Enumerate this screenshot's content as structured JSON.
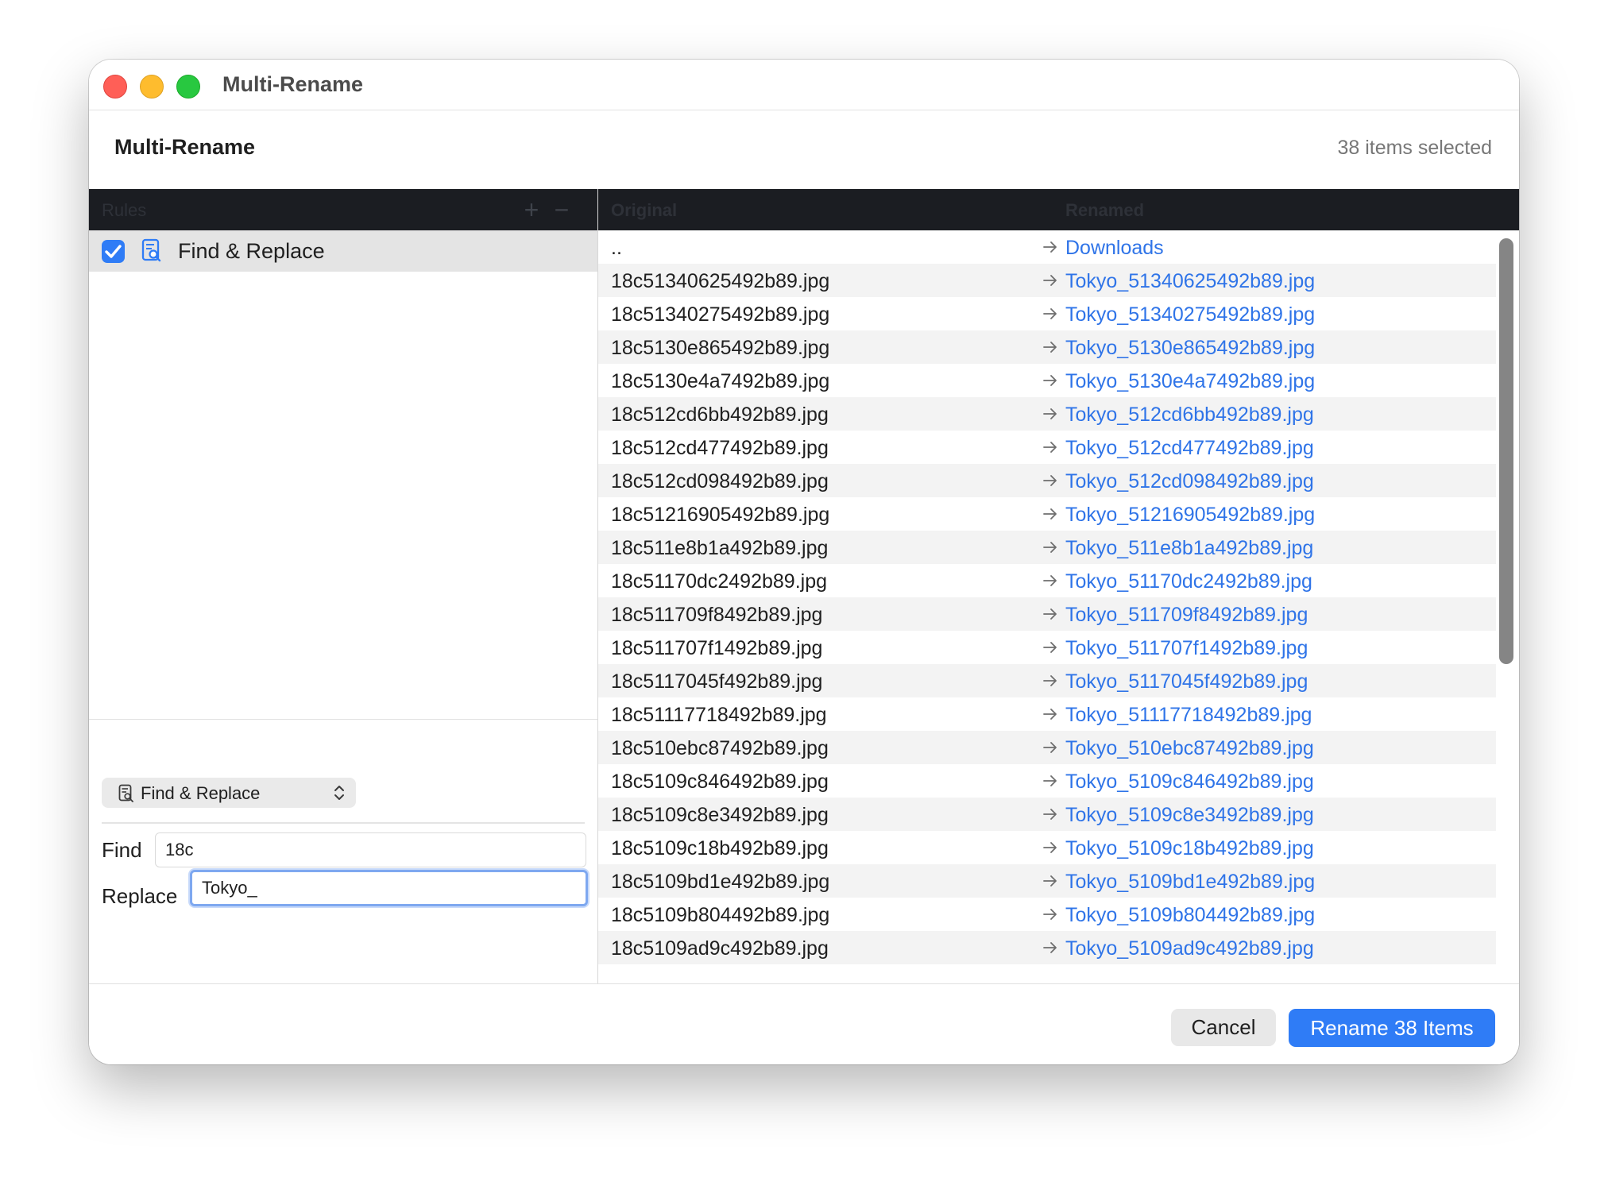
{
  "window": {
    "title": "Multi-Rename"
  },
  "header": {
    "title": "Multi-Rename",
    "selected_count": "38 items selected"
  },
  "rules": {
    "header_label": "Rules",
    "add_icon": "plus-icon",
    "remove_icon": "minus-icon",
    "items": [
      {
        "label": "Find & Replace",
        "checked": true,
        "icon": "document-search-icon"
      }
    ],
    "selected_rule_type": "Find & Replace",
    "find_label": "Find",
    "find_value": "18c",
    "replace_label": "Replace",
    "replace_value": "Tokyo_"
  },
  "preview": {
    "columns": {
      "original": "Original",
      "renamed": "Renamed"
    },
    "rows": [
      {
        "original": "..",
        "renamed": "Downloads"
      },
      {
        "original": "18c51340625492b89.jpg",
        "renamed": "Tokyo_51340625492b89.jpg"
      },
      {
        "original": "18c51340275492b89.jpg",
        "renamed": "Tokyo_51340275492b89.jpg"
      },
      {
        "original": "18c5130e865492b89.jpg",
        "renamed": "Tokyo_5130e865492b89.jpg"
      },
      {
        "original": "18c5130e4a7492b89.jpg",
        "renamed": "Tokyo_5130e4a7492b89.jpg"
      },
      {
        "original": "18c512cd6bb492b89.jpg",
        "renamed": "Tokyo_512cd6bb492b89.jpg"
      },
      {
        "original": "18c512cd477492b89.jpg",
        "renamed": "Tokyo_512cd477492b89.jpg"
      },
      {
        "original": "18c512cd098492b89.jpg",
        "renamed": "Tokyo_512cd098492b89.jpg"
      },
      {
        "original": "18c51216905492b89.jpg",
        "renamed": "Tokyo_51216905492b89.jpg"
      },
      {
        "original": "18c511e8b1a492b89.jpg",
        "renamed": "Tokyo_511e8b1a492b89.jpg"
      },
      {
        "original": "18c51170dc2492b89.jpg",
        "renamed": "Tokyo_51170dc2492b89.jpg"
      },
      {
        "original": "18c511709f8492b89.jpg",
        "renamed": "Tokyo_511709f8492b89.jpg"
      },
      {
        "original": "18c511707f1492b89.jpg",
        "renamed": "Tokyo_511707f1492b89.jpg"
      },
      {
        "original": "18c5117045f492b89.jpg",
        "renamed": "Tokyo_5117045f492b89.jpg"
      },
      {
        "original": "18c51117718492b89.jpg",
        "renamed": "Tokyo_51117718492b89.jpg"
      },
      {
        "original": "18c510ebc87492b89.jpg",
        "renamed": "Tokyo_510ebc87492b89.jpg"
      },
      {
        "original": "18c5109c846492b89.jpg",
        "renamed": "Tokyo_5109c846492b89.jpg"
      },
      {
        "original": "18c5109c8e3492b89.jpg",
        "renamed": "Tokyo_5109c8e3492b89.jpg"
      },
      {
        "original": "18c5109c18b492b89.jpg",
        "renamed": "Tokyo_5109c18b492b89.jpg"
      },
      {
        "original": "18c5109bd1e492b89.jpg",
        "renamed": "Tokyo_5109bd1e492b89.jpg"
      },
      {
        "original": "18c5109b804492b89.jpg",
        "renamed": "Tokyo_5109b804492b89.jpg"
      },
      {
        "original": "18c5109ad9c492b89.jpg",
        "renamed": "Tokyo_5109ad9c492b89.jpg"
      }
    ]
  },
  "footer": {
    "cancel_label": "Cancel",
    "rename_label": "Rename 38 Items"
  },
  "colors": {
    "accent": "#2f7cf6",
    "renamed_text": "#2f74e8",
    "header_bar": "#1b1d22"
  }
}
